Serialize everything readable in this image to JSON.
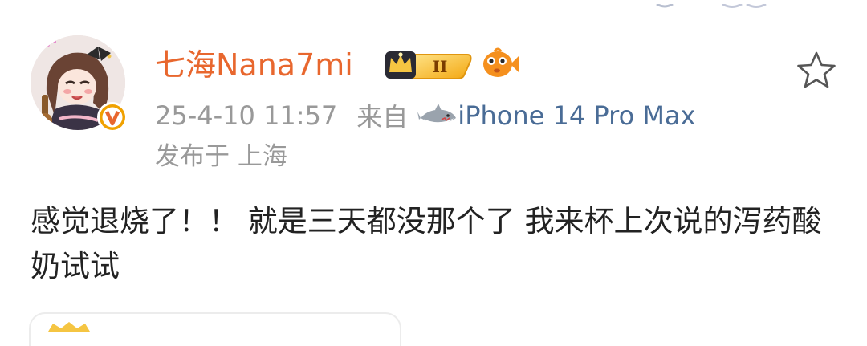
{
  "post": {
    "username": "七海Nana7mi",
    "crown_level": "II",
    "timestamp": "25-4-10 11:57",
    "from_label": "来自",
    "device": "iPhone 14 Pro Max",
    "location": "发布于 上海",
    "content": "感觉退烧了！！ 就是三天都没那个了 我来杯上次说的泻药酸奶试试"
  },
  "icons": {
    "avatar": "anime-girl-avatar",
    "verified": "orange-v-verified-badge",
    "crown": "crown-level-badge",
    "fish": "orange-fish-badge",
    "favorite": "star-outline-icon",
    "device_badge": "shark-icon"
  },
  "colors": {
    "username": "#e8672e",
    "meta": "#999999",
    "device_link": "#4a6c96",
    "content": "#222222",
    "verified": "#f0a100"
  }
}
